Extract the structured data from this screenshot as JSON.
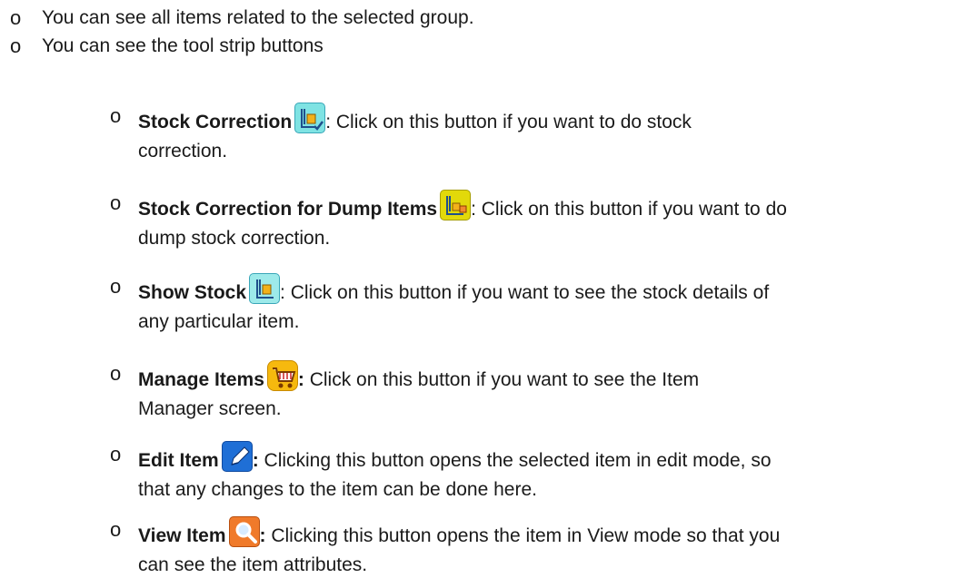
{
  "bullet_glyph": "o",
  "top_items": [
    {
      "text": "You can see all items related to the selected group."
    },
    {
      "text": "You can see the tool strip buttons"
    }
  ],
  "buttons": [
    {
      "name": "Stock Correction",
      "colon": ":",
      "line1": " Click on this button if you want to do stock",
      "line2": "correction.",
      "icon": "stock-correction-icon"
    },
    {
      "name": "Stock Correction for Dump Items",
      "colon": ":",
      "line1": " Click on this button if you want to do",
      "line2": "dump stock correction.",
      "icon": "dump-stock-correction-icon"
    },
    {
      "name": "Show Stock",
      "colon": ":",
      "line1": " Click on this button if you want to see the stock details of",
      "line2": "any particular item.",
      "icon": "show-stock-icon"
    },
    {
      "name": "Manage Items",
      "colon": ":",
      "line1": " Click on this button if you want to see the Item",
      "line2": "Manager screen.",
      "icon": "shopping-cart-icon"
    },
    {
      "name": "Edit Item",
      "colon": ":",
      "line1": " Clicking this button opens the selected item in edit mode, so",
      "line2": "that any changes to the item can be done here.",
      "icon": "pencil-edit-icon"
    },
    {
      "name": "View Item",
      "colon": ":",
      "line1": " Clicking this button opens the item in View mode so that you",
      "line2": "can see the item attributes.",
      "icon": "magnifier-view-icon"
    }
  ]
}
